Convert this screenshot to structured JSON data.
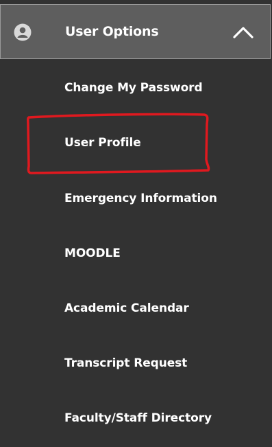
{
  "header": {
    "title": "User Options",
    "icon": "user-avatar-icon",
    "toggle_icon": "chevron-up-icon",
    "expanded": true
  },
  "menu": {
    "items": [
      {
        "label": "Change My Password"
      },
      {
        "label": "User Profile",
        "highlighted": true
      },
      {
        "label": "Emergency Information"
      },
      {
        "label": "MOODLE"
      },
      {
        "label": "Academic Calendar"
      },
      {
        "label": "Transcript Request"
      },
      {
        "label": "Faculty/Staff Directory"
      }
    ]
  },
  "colors": {
    "background": "#323232",
    "header_background": "#5e5e5e",
    "text": "#ffffff",
    "annotation": "#e0191f"
  }
}
